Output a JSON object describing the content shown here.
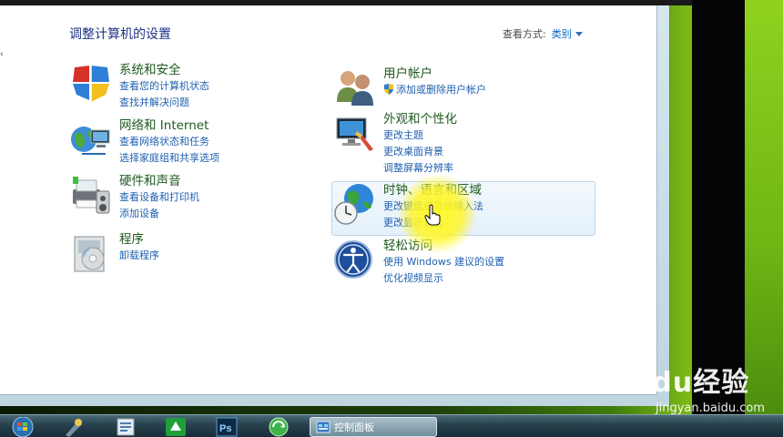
{
  "header": {
    "page_title": "调整计算机的设置",
    "view_by_label": "查看方式:",
    "view_by_value": "类别"
  },
  "categories": [
    {
      "title": "系统和安全",
      "links": [
        "查看您的计算机状态",
        "查找并解决问题"
      ],
      "icon": "system-security-icon"
    },
    {
      "title": "网络和 Internet",
      "links": [
        "查看网络状态和任务",
        "选择家庭组和共享选项"
      ],
      "icon": "network-icon"
    },
    {
      "title": "硬件和声音",
      "links": [
        "查看设备和打印机",
        "添加设备"
      ],
      "icon": "hardware-sound-icon"
    },
    {
      "title": "程序",
      "links": [
        "卸载程序"
      ],
      "icon": "programs-icon"
    },
    {
      "title": "用户帐户",
      "links": [
        "添加或删除用户帐户"
      ],
      "icon": "user-accounts-icon"
    },
    {
      "title": "外观和个性化",
      "links": [
        "更改主题",
        "更改桌面背景",
        "调整屏幕分辨率"
      ],
      "icon": "appearance-icon"
    },
    {
      "title": "时钟、语言和区域",
      "links": [
        "更改键盘或其他输入法",
        "更改显示语言"
      ],
      "icon": "clock-language-icon"
    },
    {
      "title": "轻松访问",
      "links": [
        "使用 Windows 建议的设置",
        "优化视频显示"
      ],
      "icon": "ease-of-access-icon"
    }
  ],
  "taskbar": {
    "active_window_label": "控制面板"
  },
  "watermark": {
    "logo": "Baidu经验",
    "url": "jingyan.baidu.com"
  },
  "colors": {
    "title_blue": "#1e3287",
    "category_green": "#1e5a20",
    "link_blue": "#1f5fb0",
    "highlight_yellow": "#fff21e"
  }
}
